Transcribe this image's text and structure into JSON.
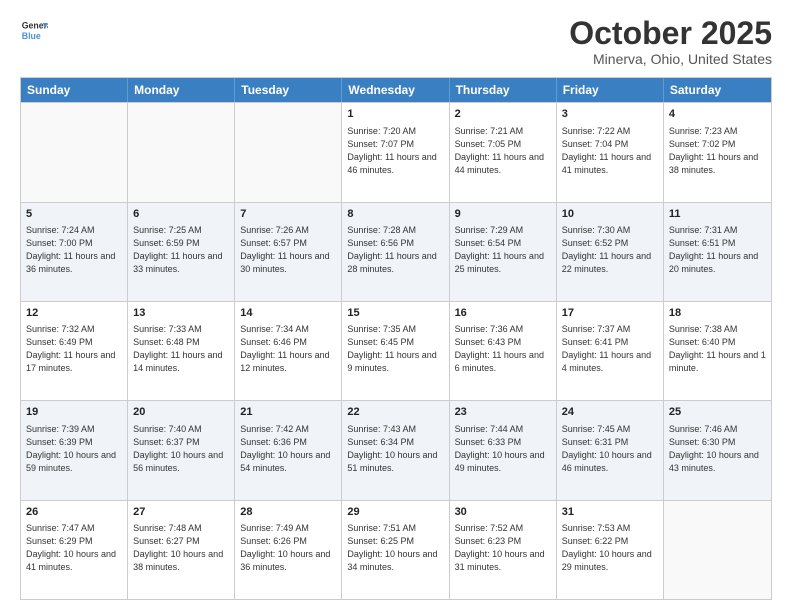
{
  "header": {
    "logo_line1": "General",
    "logo_line2": "Blue",
    "month": "October 2025",
    "location": "Minerva, Ohio, United States"
  },
  "days_of_week": [
    "Sunday",
    "Monday",
    "Tuesday",
    "Wednesday",
    "Thursday",
    "Friday",
    "Saturday"
  ],
  "rows": [
    [
      {
        "day": "",
        "info": ""
      },
      {
        "day": "",
        "info": ""
      },
      {
        "day": "",
        "info": ""
      },
      {
        "day": "1",
        "info": "Sunrise: 7:20 AM\nSunset: 7:07 PM\nDaylight: 11 hours and 46 minutes."
      },
      {
        "day": "2",
        "info": "Sunrise: 7:21 AM\nSunset: 7:05 PM\nDaylight: 11 hours and 44 minutes."
      },
      {
        "day": "3",
        "info": "Sunrise: 7:22 AM\nSunset: 7:04 PM\nDaylight: 11 hours and 41 minutes."
      },
      {
        "day": "4",
        "info": "Sunrise: 7:23 AM\nSunset: 7:02 PM\nDaylight: 11 hours and 38 minutes."
      }
    ],
    [
      {
        "day": "5",
        "info": "Sunrise: 7:24 AM\nSunset: 7:00 PM\nDaylight: 11 hours and 36 minutes."
      },
      {
        "day": "6",
        "info": "Sunrise: 7:25 AM\nSunset: 6:59 PM\nDaylight: 11 hours and 33 minutes."
      },
      {
        "day": "7",
        "info": "Sunrise: 7:26 AM\nSunset: 6:57 PM\nDaylight: 11 hours and 30 minutes."
      },
      {
        "day": "8",
        "info": "Sunrise: 7:28 AM\nSunset: 6:56 PM\nDaylight: 11 hours and 28 minutes."
      },
      {
        "day": "9",
        "info": "Sunrise: 7:29 AM\nSunset: 6:54 PM\nDaylight: 11 hours and 25 minutes."
      },
      {
        "day": "10",
        "info": "Sunrise: 7:30 AM\nSunset: 6:52 PM\nDaylight: 11 hours and 22 minutes."
      },
      {
        "day": "11",
        "info": "Sunrise: 7:31 AM\nSunset: 6:51 PM\nDaylight: 11 hours and 20 minutes."
      }
    ],
    [
      {
        "day": "12",
        "info": "Sunrise: 7:32 AM\nSunset: 6:49 PM\nDaylight: 11 hours and 17 minutes."
      },
      {
        "day": "13",
        "info": "Sunrise: 7:33 AM\nSunset: 6:48 PM\nDaylight: 11 hours and 14 minutes."
      },
      {
        "day": "14",
        "info": "Sunrise: 7:34 AM\nSunset: 6:46 PM\nDaylight: 11 hours and 12 minutes."
      },
      {
        "day": "15",
        "info": "Sunrise: 7:35 AM\nSunset: 6:45 PM\nDaylight: 11 hours and 9 minutes."
      },
      {
        "day": "16",
        "info": "Sunrise: 7:36 AM\nSunset: 6:43 PM\nDaylight: 11 hours and 6 minutes."
      },
      {
        "day": "17",
        "info": "Sunrise: 7:37 AM\nSunset: 6:41 PM\nDaylight: 11 hours and 4 minutes."
      },
      {
        "day": "18",
        "info": "Sunrise: 7:38 AM\nSunset: 6:40 PM\nDaylight: 11 hours and 1 minute."
      }
    ],
    [
      {
        "day": "19",
        "info": "Sunrise: 7:39 AM\nSunset: 6:39 PM\nDaylight: 10 hours and 59 minutes."
      },
      {
        "day": "20",
        "info": "Sunrise: 7:40 AM\nSunset: 6:37 PM\nDaylight: 10 hours and 56 minutes."
      },
      {
        "day": "21",
        "info": "Sunrise: 7:42 AM\nSunset: 6:36 PM\nDaylight: 10 hours and 54 minutes."
      },
      {
        "day": "22",
        "info": "Sunrise: 7:43 AM\nSunset: 6:34 PM\nDaylight: 10 hours and 51 minutes."
      },
      {
        "day": "23",
        "info": "Sunrise: 7:44 AM\nSunset: 6:33 PM\nDaylight: 10 hours and 49 minutes."
      },
      {
        "day": "24",
        "info": "Sunrise: 7:45 AM\nSunset: 6:31 PM\nDaylight: 10 hours and 46 minutes."
      },
      {
        "day": "25",
        "info": "Sunrise: 7:46 AM\nSunset: 6:30 PM\nDaylight: 10 hours and 43 minutes."
      }
    ],
    [
      {
        "day": "26",
        "info": "Sunrise: 7:47 AM\nSunset: 6:29 PM\nDaylight: 10 hours and 41 minutes."
      },
      {
        "day": "27",
        "info": "Sunrise: 7:48 AM\nSunset: 6:27 PM\nDaylight: 10 hours and 38 minutes."
      },
      {
        "day": "28",
        "info": "Sunrise: 7:49 AM\nSunset: 6:26 PM\nDaylight: 10 hours and 36 minutes."
      },
      {
        "day": "29",
        "info": "Sunrise: 7:51 AM\nSunset: 6:25 PM\nDaylight: 10 hours and 34 minutes."
      },
      {
        "day": "30",
        "info": "Sunrise: 7:52 AM\nSunset: 6:23 PM\nDaylight: 10 hours and 31 minutes."
      },
      {
        "day": "31",
        "info": "Sunrise: 7:53 AM\nSunset: 6:22 PM\nDaylight: 10 hours and 29 minutes."
      },
      {
        "day": "",
        "info": ""
      }
    ]
  ]
}
